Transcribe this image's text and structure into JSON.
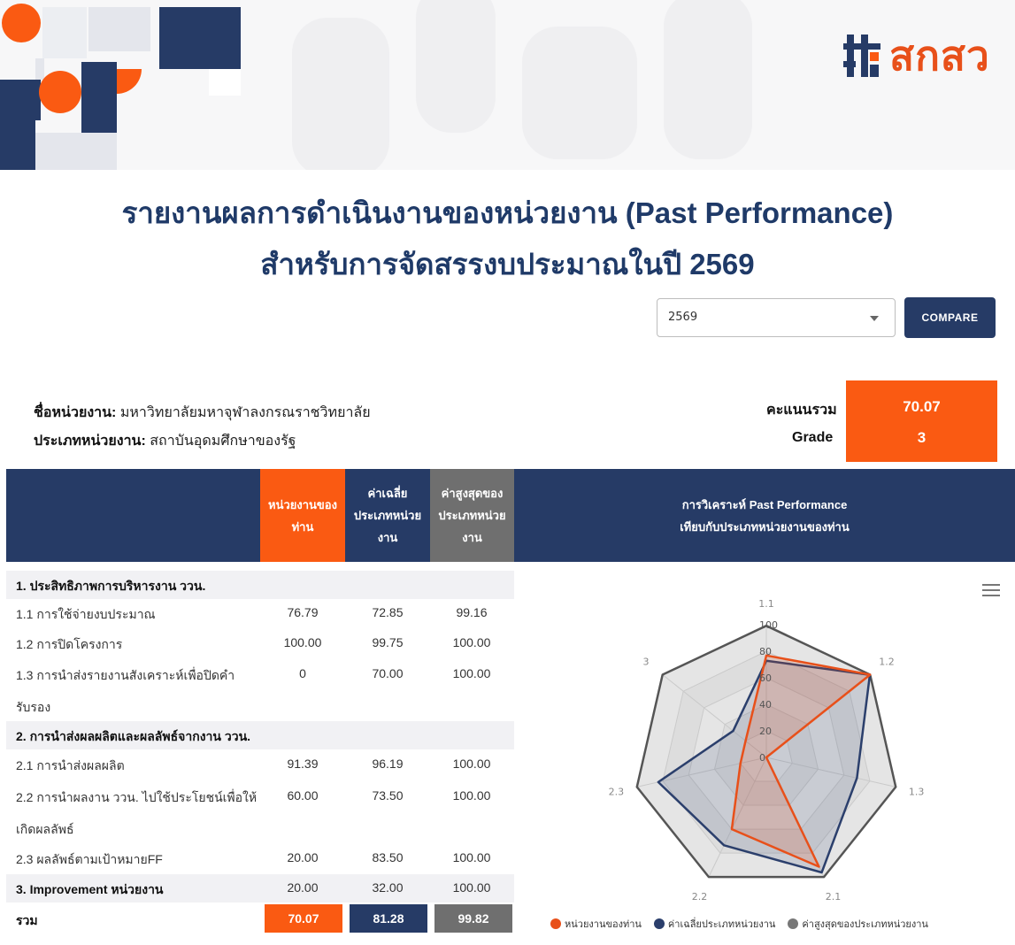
{
  "logo": {
    "text": "สกสว"
  },
  "title": {
    "line1": "รายงานผลการดำเนินงานของหน่วยงาน (Past Performance)",
    "line2": "สำหรับการจัดสรรงบประมาณในปี 2569"
  },
  "controls": {
    "year_value": "2569",
    "compare_label": "COMPARE"
  },
  "org": {
    "name_label": "ชื่อหน่วยงาน:",
    "name_value": "มหาวิทยาลัยมหาจุฬาลงกรณราชวิทยาลัย",
    "type_label": "ประเภทหน่วยงาน:",
    "type_value": "สถาบันอุดมศึกษาของรัฐ"
  },
  "score": {
    "total_label": "คะแนนรวม",
    "total_value": "70.07",
    "grade_label": "Grade",
    "grade_value": "3"
  },
  "table": {
    "headers": {
      "yours": "หน่วยงานของท่าน",
      "avg": "ค่าเฉลี่ยประเภทหน่วยงาน",
      "max": "ค่าสูงสุดของประเภทหน่วยงาน",
      "analysis_line1": "การวิเคราะห์ Past Performance",
      "analysis_line2": "เทียบกับประเภทหน่วยงานของท่าน"
    },
    "rows": [
      {
        "label": "1. ประสิทธิภาพการบริหารงาน ววน.",
        "section": true
      },
      {
        "label": "1.1 การใช้จ่ายงบประมาณ",
        "v1": "76.79",
        "v2": "72.85",
        "v3": "99.16"
      },
      {
        "label": "1.2 การปิดโครงการ",
        "v1": "100.00",
        "v2": "99.75",
        "v3": "100.00"
      },
      {
        "label": "1.3 การนำส่งรายงานสังเคราะห์เพื่อปิดคำ",
        "label2": "รับรอง",
        "v1": "0",
        "v2": "70.00",
        "v3": "100.00"
      },
      {
        "label": "2. การนำส่งผลผลิตและผลลัพธ์จากงาน ววน.",
        "section": true
      },
      {
        "label": "2.1 การนำส่งผลผลิต",
        "v1": "91.39",
        "v2": "96.19",
        "v3": "100.00"
      },
      {
        "label": "2.2 การนำผลงาน ววน. ไปใช้ประโยชน์เพื่อให้",
        "label2": "เกิดผลลัพธ์",
        "v1": "60.00",
        "v2": "73.50",
        "v3": "100.00"
      },
      {
        "label": "2.3 ผลลัพธ์ตามเป้าหมายFF",
        "v1": "20.00",
        "v2": "83.50",
        "v3": "100.00"
      },
      {
        "label": "3. Improvement หน่วยงาน",
        "section": true,
        "v1": "20.00",
        "v2": "32.00",
        "v3": "100.00"
      }
    ],
    "total": {
      "label": "รวม",
      "v1": "70.07",
      "v2": "81.28",
      "v3": "99.82"
    }
  },
  "colors": {
    "navy": "#263b66",
    "orange": "#fa5a12",
    "gray": "#777777"
  },
  "chart_data": {
    "type": "radar",
    "categories": [
      "1.1",
      "1.2",
      "1.3",
      "2.1",
      "2.2",
      "2.3",
      "3"
    ],
    "ylim": [
      0,
      100
    ],
    "ticks": [
      "0",
      "20",
      "40",
      "60",
      "80",
      "100"
    ],
    "series": [
      {
        "name": "หน่วยงานของท่าน",
        "color": "#e8501a",
        "values": [
          76.79,
          100,
          0,
          91.39,
          60,
          20,
          20
        ]
      },
      {
        "name": "ค่าเฉลี่ยประเภทหน่วยงาน",
        "color": "#2b3f6c",
        "values": [
          72.85,
          99.75,
          70,
          96.19,
          73.5,
          83.5,
          32
        ]
      },
      {
        "name": "ค่าสูงสุดของประเภทหน่วยงาน",
        "color": "#555555",
        "values": [
          99.16,
          100,
          100,
          100,
          100,
          100,
          100
        ]
      }
    ],
    "legend": "bottom"
  }
}
